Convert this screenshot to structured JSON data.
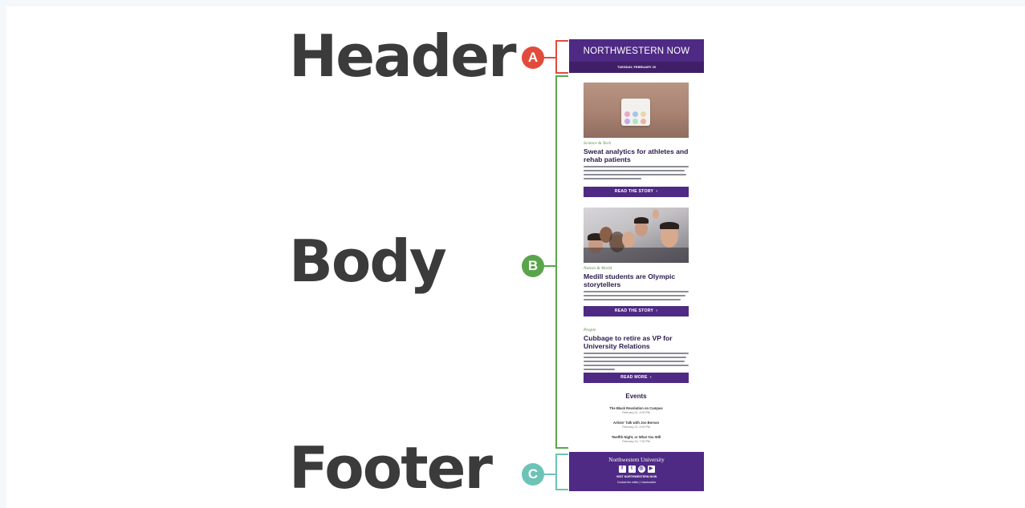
{
  "labels": {
    "header": "Header",
    "body": "Body",
    "footer": "Footer"
  },
  "badges": {
    "a": "A",
    "b": "B",
    "c": "C"
  },
  "colors": {
    "badge_a": "#e24b3b",
    "badge_b": "#5aa54b",
    "badge_c": "#6cc3b6",
    "brand_purple": "#4e2a84"
  },
  "email": {
    "header": {
      "title": "NORTHWESTERN NOW",
      "date": "TUESDAY, FEBRUARY 20"
    },
    "stories": [
      {
        "category": "Science & Tech",
        "headline": "Sweat analytics for athletes and rehab patients",
        "button": "READ THE STORY"
      },
      {
        "category": "Nation & World",
        "headline": "Medill students are Olympic storytellers",
        "button": "READ THE STORY"
      },
      {
        "category": "People",
        "headline": "Cubbage to retire as VP for University Relations",
        "button": "READ MORE"
      }
    ],
    "events": {
      "title": "Events",
      "items": [
        {
          "name": "The Black Revolution on Campus",
          "date": "February 21, 4:00 PM"
        },
        {
          "name": "Artists' Talk with Jon Berson",
          "date": "February 21, 6:00 PM"
        },
        {
          "name": "Twelfth Night, or What You Will",
          "date": "February 23, 7:30 PM"
        }
      ]
    },
    "footer": {
      "title": "Northwestern University",
      "social": [
        "f",
        "t",
        "◎",
        "▶"
      ],
      "visit": "VISIT NORTHWESTERN NOW",
      "links": "Contact the editor | Unsubscribe"
    }
  }
}
